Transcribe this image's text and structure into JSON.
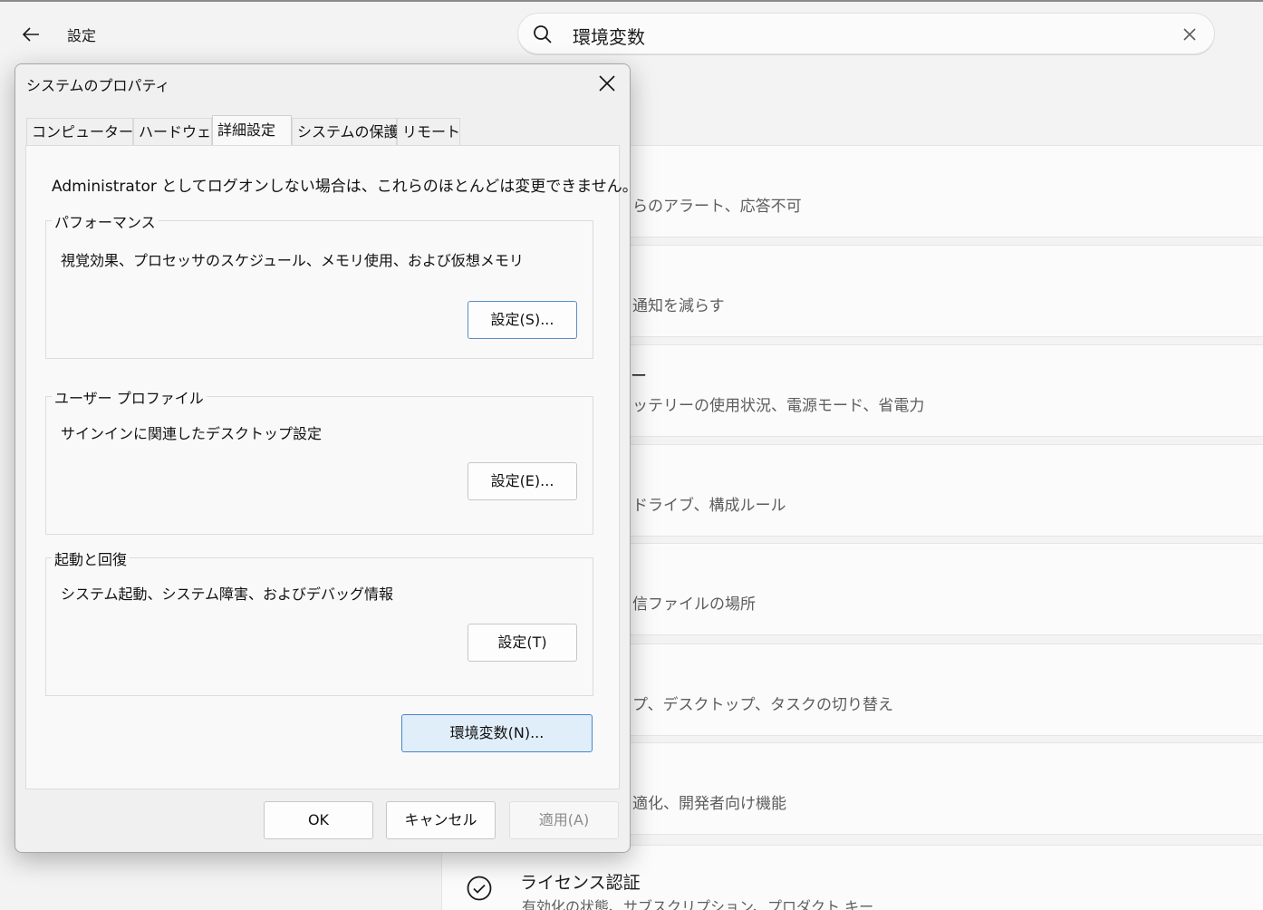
{
  "settings": {
    "app_title": "設定",
    "search": {
      "value": "環境変数"
    },
    "results": [
      {
        "desc": "らのアラート、応答不可"
      },
      {
        "desc": "通知を減らす"
      },
      {
        "title_fragment": "ー",
        "desc": "ッテリーの使用状況、電源モード、省電力"
      },
      {
        "desc": "ドライブ、構成ルール"
      },
      {
        "desc": "信ファイルの場所"
      },
      {
        "desc": "プ、デスクトップ、タスクの切り替え"
      },
      {
        "desc": "適化、開発者向け機能"
      }
    ],
    "license": {
      "title": "ライセンス認証",
      "desc": "有効化の状態、サブスクリプション、プロダクト キー"
    }
  },
  "dialog": {
    "title": "システムのプロパティ",
    "tabs": [
      "コンピューター名",
      "ハードウェア",
      "詳細設定",
      "システムの保護",
      "リモート"
    ],
    "active_tab": "詳細設定",
    "admin_note": "Administrator としてログオンしない場合は、これらのほとんどは変更できません。",
    "performance": {
      "label": "パフォーマンス",
      "desc": "視覚効果、プロセッサのスケジュール、メモリ使用、および仮想メモリ",
      "button": "設定(S)..."
    },
    "user_profile": {
      "label": "ユーザー プロファイル",
      "desc": "サインインに関連したデスクトップ設定",
      "button": "設定(E)..."
    },
    "startup": {
      "label": "起動と回復",
      "desc": "システム起動、システム障害、およびデバッグ情報",
      "button": "設定(T)"
    },
    "env_button": "環境変数(N)...",
    "ok": "OK",
    "cancel": "キャンセル",
    "apply": "適用(A)"
  }
}
